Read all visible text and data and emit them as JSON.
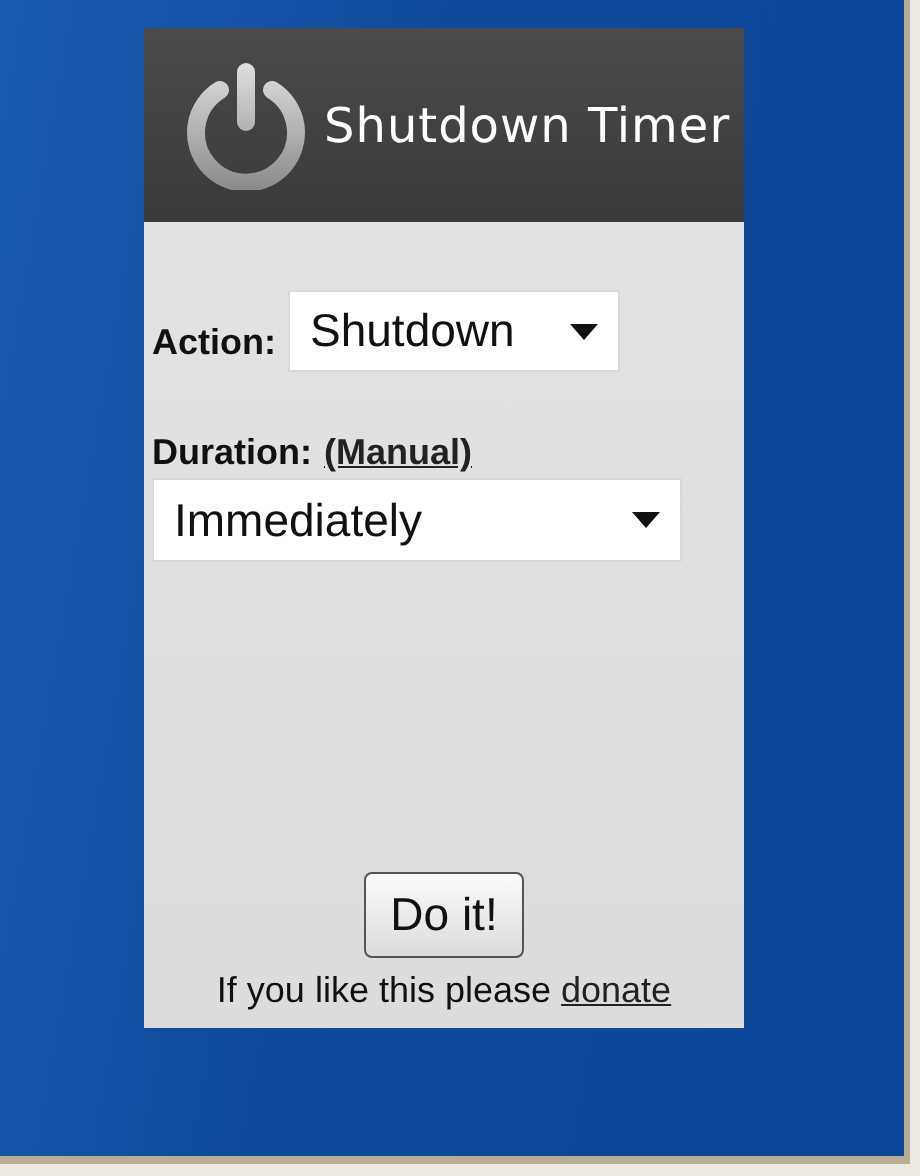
{
  "header": {
    "title": "Shutdown Timer"
  },
  "action": {
    "label": "Action:",
    "value": "Shutdown"
  },
  "duration": {
    "label": "Duration:",
    "link": "(Manual)",
    "value": "Immediately"
  },
  "button": "Do it!",
  "footer": {
    "text": "If you like this please ",
    "link": "donate"
  }
}
